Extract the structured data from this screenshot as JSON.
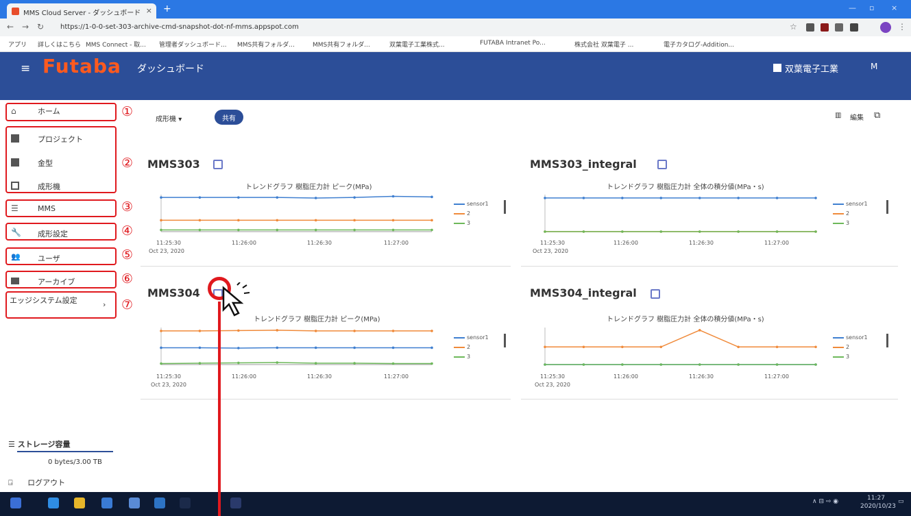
{
  "browser": {
    "tab_title": "MMS Cloud Server - ダッシュボード",
    "url": "https://1-0-0-set-303-archive-cmd-snapshot-dot-nf-mms.appspot.com",
    "bookmarks": [
      "アプリ",
      "詳しくはこちら",
      "MMS Connect - 取...",
      "管理者ダッシュボード...",
      "MMS共有フォルダ...",
      "MMS共有フォルダ...",
      "双葉電子工業株式...",
      "FUTABA Intranet Po...",
      "株式会社 双葉電子 ...",
      "電子カタログ-Addition..."
    ]
  },
  "app": {
    "logo": "Futaba",
    "title": "ダッシュボード",
    "company": "双葉電子工業",
    "user_initial": "M"
  },
  "sidebar": {
    "items": [
      {
        "label": "ホーム",
        "icon": "home-icon"
      },
      {
        "label": "プロジェクト",
        "icon": "project-icon"
      },
      {
        "label": "金型",
        "icon": "mold-icon"
      },
      {
        "label": "成形機",
        "icon": "machine-icon"
      },
      {
        "label": "MMS",
        "icon": "list-icon"
      },
      {
        "label": "成形設定",
        "icon": "wrench-icon"
      },
      {
        "label": "ユーザ",
        "icon": "users-icon"
      },
      {
        "label": "アーカイブ",
        "icon": "folder-icon"
      },
      {
        "label": "エッジシステム設定",
        "icon": "chevron-right-icon"
      }
    ],
    "storage_label": "ストレージ容量",
    "storage_value": "0 bytes/3.00 TB",
    "logout_label": "ログアウト"
  },
  "annotations": [
    "①",
    "②",
    "③",
    "④",
    "⑤",
    "⑥",
    "⑦"
  ],
  "toolbar": {
    "selector_label": "成形機",
    "share_label": "共有",
    "edit_label": "編集"
  },
  "panels": [
    {
      "title": "MMS303",
      "chart_title": "トレンドグラフ 樹脂圧力計 ピーク(MPa)"
    },
    {
      "title": "MMS303_integral",
      "chart_title": "トレンドグラフ 樹脂圧力計 全体の積分値(MPa・s)"
    },
    {
      "title": "MMS304",
      "chart_title": "トレンドグラフ 樹脂圧力計 ピーク(MPa)"
    },
    {
      "title": "MMS304_integral",
      "chart_title": "トレンドグラフ 樹脂圧力計 全体の積分値(MPa・s)"
    }
  ],
  "x_ticks": [
    "11:25:30",
    "11:26:00",
    "11:26:30",
    "11:27:00"
  ],
  "x_date": "Oct 23, 2020",
  "legend": [
    "sensor1",
    "2",
    "3"
  ],
  "colors": {
    "s1": "#3f7fd0",
    "s2": "#f08a3a",
    "s3": "#6db85a",
    "s4": "#9b3a3a",
    "accent": "#2c4e98",
    "annotation": "#e0191e"
  },
  "tray_time": "11:27",
  "tray_date": "2020/10/23",
  "chart_data": [
    {
      "type": "line",
      "title": "トレンドグラフ 樹脂圧力計 ピーク(MPa)",
      "x": [
        "11:25:30",
        "11:25:45",
        "11:26:00",
        "11:26:15",
        "11:26:30",
        "11:26:45",
        "11:27:00",
        "11:27:15"
      ],
      "series": [
        {
          "name": "sensor1",
          "values": [
            60,
            60,
            60,
            60,
            59,
            60,
            62,
            61
          ]
        },
        {
          "name": "2",
          "values": [
            20,
            20,
            20,
            20,
            20,
            20,
            20,
            20
          ]
        },
        {
          "name": "3",
          "values": [
            3,
            3,
            3,
            3,
            3,
            3,
            3,
            3
          ]
        }
      ],
      "ylim": [
        0,
        65
      ]
    },
    {
      "type": "line",
      "title": "トレンドグラフ 樹脂圧力計 全体の積分値(MPa・s)",
      "x": [
        "11:25:30",
        "11:25:45",
        "11:26:00",
        "11:26:15",
        "11:26:30",
        "11:26:45",
        "11:27:00",
        "11:27:15"
      ],
      "series": [
        {
          "name": "sensor1",
          "values": [
            200,
            200,
            200,
            200,
            200,
            200,
            200,
            200
          ]
        },
        {
          "name": "2",
          "values": [
            0,
            0,
            0,
            0,
            0,
            0,
            0,
            0
          ]
        },
        {
          "name": "3",
          "values": [
            0,
            0,
            0,
            0,
            0,
            0,
            0,
            0
          ]
        }
      ],
      "ylim": [
        0,
        220
      ]
    },
    {
      "type": "line",
      "title": "トレンドグラフ 樹脂圧力計 ピーク(MPa)",
      "x": [
        "11:25:30",
        "11:25:45",
        "11:26:00",
        "11:26:15",
        "11:26:30",
        "11:26:45",
        "11:27:00",
        "11:27:15"
      ],
      "series": [
        {
          "name": "sensor1",
          "values": [
            50,
            50,
            49,
            50,
            50,
            50,
            50,
            50
          ]
        },
        {
          "name": "2",
          "values": [
            100,
            100,
            101,
            102,
            100,
            100,
            100,
            100
          ]
        },
        {
          "name": "3",
          "values": [
            3,
            4,
            5,
            6,
            4,
            4,
            3,
            3
          ]
        }
      ],
      "ylim": [
        0,
        110
      ]
    },
    {
      "type": "line",
      "title": "トレンドグラフ 樹脂圧力計 全体の積分値(MPa・s)",
      "x": [
        "11:25:30",
        "11:25:45",
        "11:26:00",
        "11:26:15",
        "11:26:30",
        "11:26:45",
        "11:27:00",
        "11:27:15"
      ],
      "series": [
        {
          "name": "sensor1",
          "values": [
            0,
            0,
            0,
            0,
            0,
            0,
            0,
            0
          ]
        },
        {
          "name": "2",
          "values": [
            100,
            100,
            100,
            100,
            195,
            100,
            100,
            100
          ]
        },
        {
          "name": "3",
          "values": [
            0,
            0,
            0,
            0,
            0,
            0,
            0,
            0
          ]
        }
      ],
      "ylim": [
        0,
        210
      ]
    }
  ]
}
